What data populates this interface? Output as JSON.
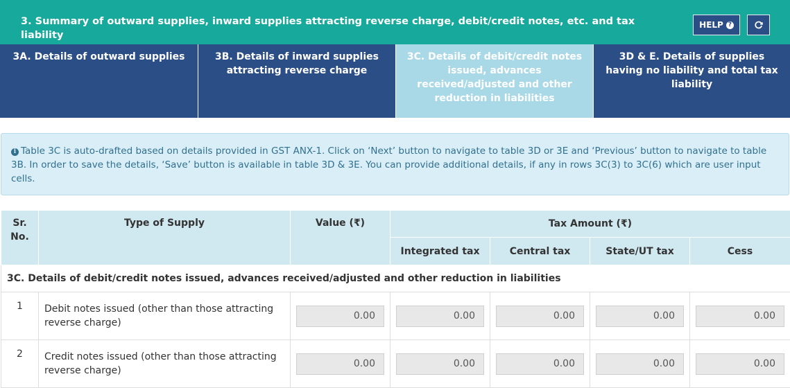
{
  "header": {
    "title": "3. Summary of outward supplies, inward supplies attracting reverse charge, debit/credit notes, etc. and tax liability",
    "help_label": "HELP",
    "help_icon": "question-circle-icon",
    "refresh_icon": "refresh-icon"
  },
  "tabs": [
    {
      "label": "3A. Details of outward supplies",
      "active": false
    },
    {
      "label": "3B. Details of inward supplies attracting reverse charge",
      "active": false
    },
    {
      "label": "3C. Details of debit/credit notes issued, advances received/adjusted and other reduction in liabilities",
      "active": true
    },
    {
      "label": "3D & E. Details of supplies having no liability and total tax liability",
      "active": false
    }
  ],
  "info": {
    "icon": "info-circle-icon",
    "text": "Table 3C is auto-drafted based on details provided in GST ANX-1. Click on ‘Next’ button to navigate to table 3D or 3E and ‘Previous’ button to navigate to table 3B. In order to save the details, ‘Save’ button is available in table 3D & 3E. You can provide additional details, if any in rows 3C(3) to 3C(6) which are user input cells."
  },
  "table": {
    "headers": {
      "sr": "Sr. No.",
      "type": "Type of Supply",
      "value": "Value (₹)",
      "tax_amount": "Tax Amount (₹)",
      "integrated": "Integrated tax",
      "central": "Central tax",
      "state": "State/UT tax",
      "cess": "Cess"
    },
    "section_title": "3C. Details of debit/credit notes issued, advances received/adjusted and other reduction in liabilities",
    "rows": [
      {
        "sr": "1",
        "type": "Debit notes issued (other than those attracting reverse charge)",
        "value": "0.00",
        "integrated": "0.00",
        "central": "0.00",
        "state": "0.00",
        "cess": "0.00"
      },
      {
        "sr": "2",
        "type": "Credit notes issued (other than those attracting reverse charge)",
        "value": "0.00",
        "integrated": "0.00",
        "central": "0.00",
        "state": "0.00",
        "cess": "0.00"
      }
    ]
  },
  "colors": {
    "header_bg": "#17a99b",
    "tab_bg": "#2c4e86",
    "tab_active_bg": "#a9d9e7",
    "info_bg": "#d9eef6",
    "table_header_bg": "#d0e8f0"
  }
}
